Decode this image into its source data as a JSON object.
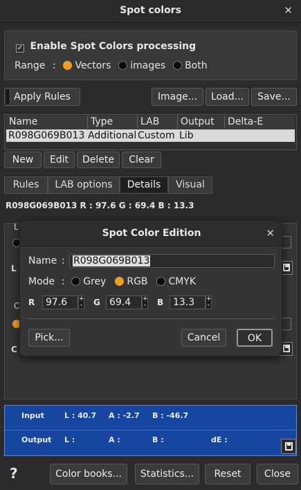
{
  "window": {
    "title": "Spot colors",
    "close_glyph": "✕"
  },
  "settings": {
    "enable_label": "Enable Spot Colors processing",
    "enable_checked": true,
    "range_label": "Range",
    "range_sep": ":",
    "range_options": [
      "Vectors",
      "images",
      "Both"
    ],
    "range_selected": "Vectors"
  },
  "toolbar": {
    "apply_rules": "Apply Rules",
    "image": "Image...",
    "load": "Load...",
    "save": "Save..."
  },
  "table": {
    "columns": [
      "Name",
      "Type",
      "LAB",
      "Output",
      "Delta-E"
    ],
    "rows": [
      {
        "name": "R098G069B013",
        "type": "Additional",
        "lab": "Custom",
        "output": "Lib",
        "delta_e": ""
      }
    ]
  },
  "row_actions": {
    "new": "New",
    "edit": "Edit",
    "delete": "Delete",
    "clear": "Clear"
  },
  "tabs": {
    "items": [
      "Rules",
      "LAB options",
      "Details",
      "Visual"
    ],
    "active": "Details"
  },
  "details": {
    "line": "R098G069B013  R : 97.6  G : 69.4  B : 13.3"
  },
  "dialog": {
    "title": "Spot Color Edition",
    "close_glyph": "✕",
    "name_label": "Name",
    "sep": ":",
    "name_value": "R098G069B013",
    "mode_label": "Mode",
    "mode_options": [
      "Grey",
      "RGB",
      "CMYK"
    ],
    "mode_selected": "RGB",
    "r_label": "R",
    "r_value": "97.6",
    "g_label": "G",
    "g_value": "69.4",
    "b_label": "B",
    "b_value": "13.3",
    "pick": "Pick...",
    "cancel": "Cancel",
    "ok": "OK"
  },
  "color_panel": {
    "input_label": "Input",
    "input_l": "L : 40.7",
    "input_a": "A : -2.7",
    "input_b": "B : -46.7",
    "output_label": "Output",
    "output_l": "L :",
    "output_a": "A :",
    "output_b": "B :",
    "output_de": "dE :",
    "bg_color": "#1746a0"
  },
  "footer": {
    "help": "?",
    "color_books": "Color books...",
    "statistics": "Statistics...",
    "reset": "Reset",
    "close": "Close"
  },
  "colors": {
    "accent": "#f0a020",
    "background": "#2b2b2b"
  }
}
